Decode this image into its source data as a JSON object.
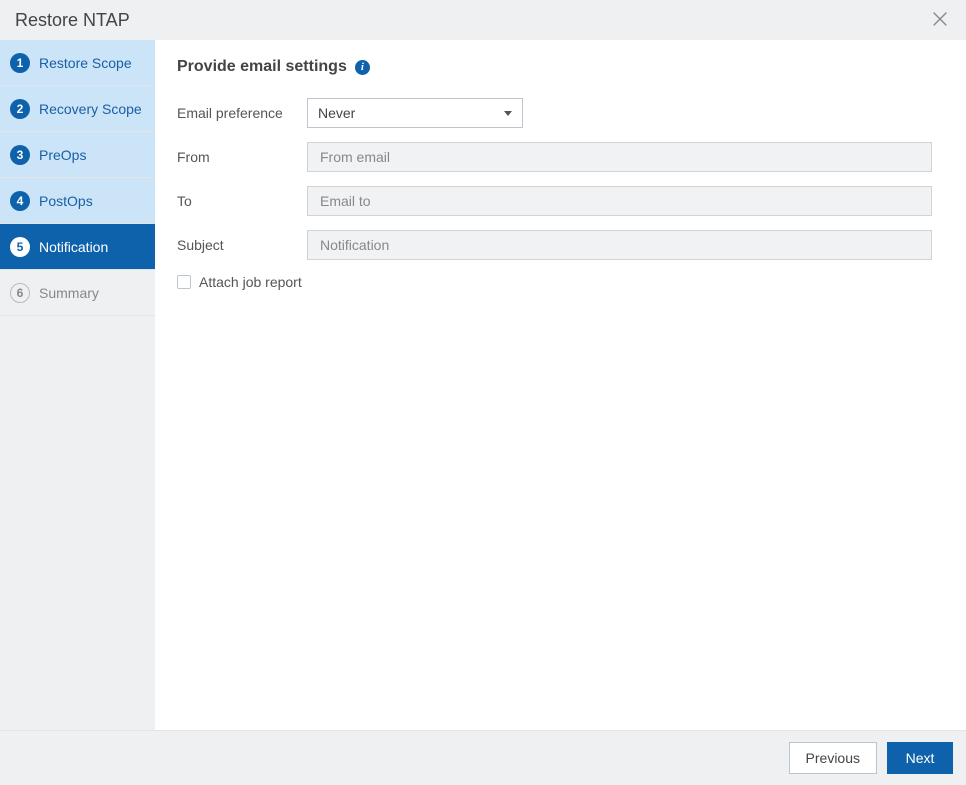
{
  "dialog": {
    "title": "Restore NTAP"
  },
  "sidebar": {
    "steps": [
      {
        "num": "1",
        "label": "Restore Scope",
        "state": "completed"
      },
      {
        "num": "2",
        "label": "Recovery Scope",
        "state": "completed"
      },
      {
        "num": "3",
        "label": "PreOps",
        "state": "completed"
      },
      {
        "num": "4",
        "label": "PostOps",
        "state": "completed"
      },
      {
        "num": "5",
        "label": "Notification",
        "state": "active"
      },
      {
        "num": "6",
        "label": "Summary",
        "state": "pending"
      }
    ]
  },
  "main": {
    "heading": "Provide email settings",
    "fields": {
      "emailPreference": {
        "label": "Email preference",
        "selected": "Never"
      },
      "from": {
        "label": "From",
        "placeholder": "From email",
        "value": ""
      },
      "to": {
        "label": "To",
        "placeholder": "Email to",
        "value": ""
      },
      "subject": {
        "label": "Subject",
        "placeholder": "Notification",
        "value": ""
      },
      "attachJobReport": {
        "label": "Attach job report",
        "checked": false
      }
    }
  },
  "footer": {
    "previous": "Previous",
    "next": "Next"
  }
}
